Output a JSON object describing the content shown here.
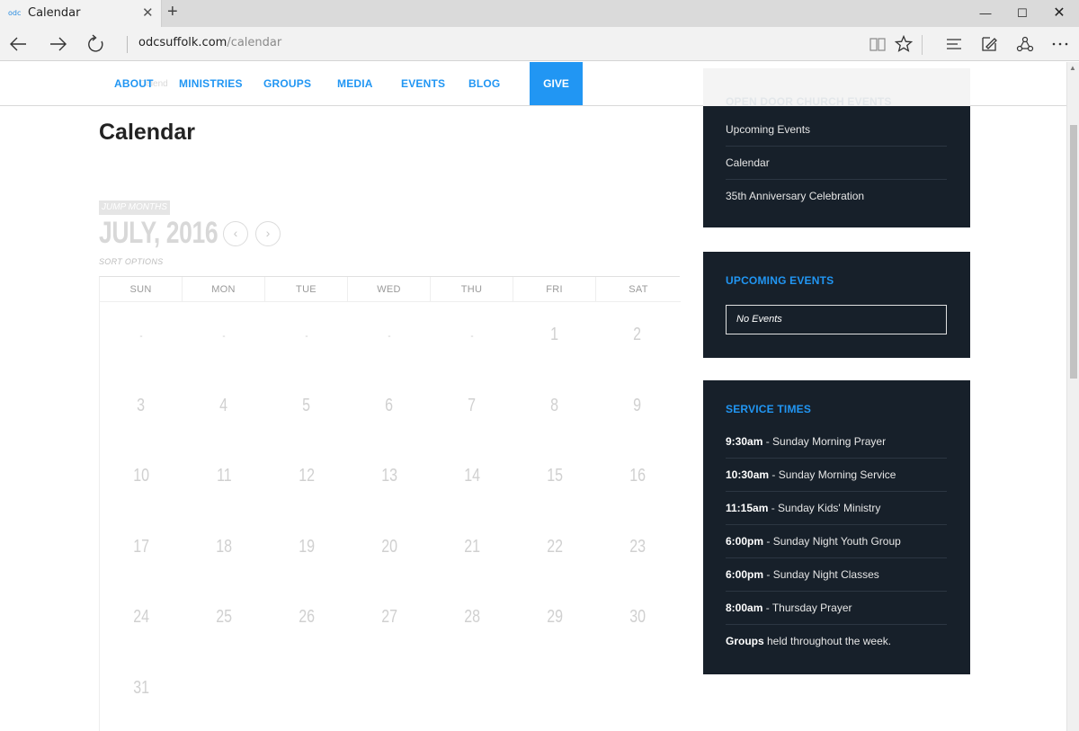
{
  "browser": {
    "tab_favicon": "odc",
    "tab_title": "Calendar",
    "url_domain": "odcsuffolk.com",
    "url_path": "/calendar"
  },
  "nav": {
    "ghost_text": "Calend",
    "items": [
      "ABOUT",
      "MINISTRIES",
      "GROUPS",
      "MEDIA",
      "EVENTS",
      "BLOG"
    ],
    "give": "GIVE",
    "accent_color": "#2196f3"
  },
  "page": {
    "title": "Calendar"
  },
  "calendar": {
    "jump_label": "JUMP MONTHS",
    "month_label": "JULY, 2016",
    "prev_icon": "‹",
    "next_icon": "›",
    "sort_label": "SORT OPTIONS",
    "weekdays": [
      "SUN",
      "MON",
      "TUE",
      "WED",
      "THU",
      "FRI",
      "SAT"
    ],
    "weeks": [
      [
        "-",
        "-",
        "-",
        "-",
        "-",
        "1",
        "2"
      ],
      [
        "3",
        "4",
        "5",
        "6",
        "7",
        "8",
        "9"
      ],
      [
        "10",
        "11",
        "12",
        "13",
        "14",
        "15",
        "16"
      ],
      [
        "17",
        "18",
        "19",
        "20",
        "21",
        "22",
        "23"
      ],
      [
        "24",
        "25",
        "26",
        "27",
        "28",
        "29",
        "30"
      ],
      [
        "31"
      ]
    ],
    "today": "20"
  },
  "sidebar": {
    "church_events": {
      "title": "OPEN DOOR CHURCH EVENTS",
      "links": [
        "Upcoming Events",
        "Calendar",
        "35th Anniversary Celebration"
      ]
    },
    "upcoming": {
      "title": "UPCOMING EVENTS",
      "empty_text": "No Events"
    },
    "service_times": {
      "title": "SERVICE TIMES",
      "rows": [
        {
          "time": "9:30am",
          "desc": " - Sunday Morning Prayer"
        },
        {
          "time": "10:30am",
          "desc": " - Sunday Morning Service"
        },
        {
          "time": "11:15am",
          "desc": " - Sunday Kids' Ministry"
        },
        {
          "time": "6:00pm",
          "desc": " - Sunday Night Youth Group"
        },
        {
          "time": "6:00pm",
          "desc": " - Sunday Night Classes"
        },
        {
          "time": "8:00am",
          "desc": " - Thursday Prayer"
        },
        {
          "time": "Groups",
          "desc": " held throughout the week."
        }
      ]
    }
  }
}
